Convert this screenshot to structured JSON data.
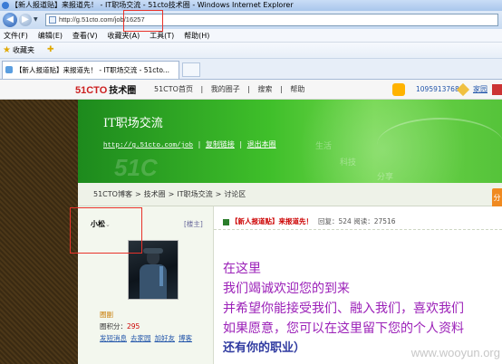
{
  "browser": {
    "title": "【新人报道贴】来报道先！ - IT职场交流 - 51cto技术圈 - Windows Internet Explorer",
    "address": "http://g.51cto.com/job/16257",
    "menu": [
      "文件(F)",
      "编辑(E)",
      "查看(V)",
      "收藏夹(A)",
      "工具(T)",
      "帮助(H)"
    ],
    "favorites_label": "收藏夹",
    "tab_title": "【新人报道贴】来报道先！ - IT职场交流 - 51cto..."
  },
  "site": {
    "logo": "51CTO",
    "logo_suffix": "技术圈",
    "nav": [
      "51CTO首页",
      "|",
      "我的圈子",
      "|",
      "搜索",
      "|",
      "帮助"
    ],
    "user_id": "1095913768",
    "home_link": "家园"
  },
  "banner": {
    "title": "IT职场交流",
    "url": "http://g.51cto.com/job",
    "copy_link": "复制链接",
    "leave": "退出本圈",
    "watermark_big": "51C",
    "watermarks": [
      "生活",
      "科技",
      "分享"
    ]
  },
  "breadcrumb": [
    "51CTO博客",
    ">",
    "技术圈",
    ">",
    "IT职场交流",
    ">",
    "讨论区"
  ],
  "side_tab": "分",
  "author": {
    "name": "小松",
    "role": "[楼主]",
    "field1": "圈副",
    "points_label": "圈积分：",
    "points": "295",
    "actions": [
      "发短消息",
      "去家园",
      "加好友",
      "博客"
    ]
  },
  "post": {
    "title": "【新人报道贴】来报道先！",
    "meta": "回复：524  阅读：27516",
    "lines": [
      "在这里",
      "我们竭诚欢迎您的到来",
      "并希望你能接受我们、融入我们，喜欢我们",
      "如果愿意，您可以在这里留下您的个人资料",
      "还有你的职业）"
    ]
  },
  "watermark": "www.wooyun.org"
}
